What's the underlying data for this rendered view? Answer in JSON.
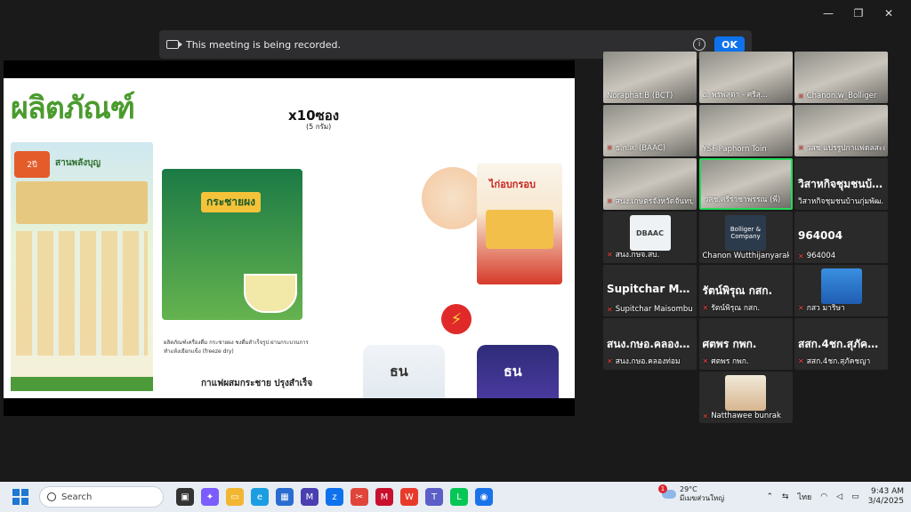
{
  "window": {
    "minimize": "—",
    "restore": "❐",
    "close": "✕"
  },
  "recording": {
    "message": "This meeting is being recorded.",
    "info": "i",
    "ok_label": "OK"
  },
  "slide": {
    "title": "ผลิตภัณฑ์",
    "brand": "สานพลังบุญ",
    "ribbon": "2ปี",
    "box_label": "กระชายผง",
    "qty": "x10ซอง",
    "qty_sub": "(5 กรัม)",
    "product_note": "ผลิตภัณฑ์เครื่องดื่ม กระชายผง ชงดื่มสำเร็จรูป ผ่านกระบวนการทำแห้งเยือกแข็ง (freeze dry)",
    "coffee_title": "กาแฟผสมกระชาย ปรุงสำเร็จ",
    "chip_title": "ไก่อบกรอบ",
    "can_brand": "ธน"
  },
  "participants": [
    {
      "name": "Noraphat.B (BCT)",
      "kind": "video",
      "muted": false
    },
    {
      "name": "อ. พรพสุดา - ศรีสุ...",
      "kind": "video",
      "muted": false
    },
    {
      "name": "Chanon.w_Bolliger",
      "kind": "video",
      "muted": true
    },
    {
      "name": "ธ.ก.ส. (BAAC)",
      "kind": "video",
      "muted": true
    },
    {
      "name": "YSF Paphorn Toin",
      "kind": "video",
      "muted": false
    },
    {
      "name": "วสช แปรรูปกาแฟดลสะดือ...",
      "kind": "video",
      "muted": true
    },
    {
      "name": "สนง.เกษตรจังหวัดจันทบุรี...",
      "kind": "video",
      "muted": true
    },
    {
      "name": "วสช.ศรีราชาพรรณ (พี่)",
      "kind": "video",
      "muted": false,
      "active": true
    },
    {
      "name": "วิสาหกิจชุมชนบ้านกุ่มพัฒ...",
      "kind": "name",
      "big": "วิสาหกิจชุมชนบ้า...",
      "muted": false
    },
    {
      "name": "สนง.กษจ.สบ.",
      "kind": "avatar",
      "avatar": "dbaac",
      "avatar_text": "DBAAC",
      "muted": true
    },
    {
      "name": "Chanon Wutthijanyarak",
      "kind": "avatar",
      "avatar": "logo",
      "avatar_text": "Bolliger & Company",
      "muted": false
    },
    {
      "name": "964004",
      "kind": "name",
      "big": "964004",
      "muted": true
    },
    {
      "name": "Supitchar Maisombun",
      "kind": "name",
      "big": "Supitchar Maiso...",
      "muted": true
    },
    {
      "name": "รัตน์พิรุณ กสก.",
      "kind": "name",
      "big": "รัตน์พิรุณ กสก.",
      "muted": true
    },
    {
      "name": "กสว มาริษา",
      "kind": "avatar",
      "avatar": "blue",
      "muted": true
    },
    {
      "name": "สนง.กษอ.คลองท่อม",
      "kind": "name",
      "big": "สนง.กษอ.คลองท่อม",
      "muted": true
    },
    {
      "name": "ศตพร กพก.",
      "kind": "name",
      "big": "ศตพร กพก.",
      "muted": true
    },
    {
      "name": "สสก.4ชก.สุภัคชญา",
      "kind": "name",
      "big": "สสก.4ชก.สุภัคชญา",
      "muted": true
    },
    {
      "name": "Natthawee bunrak",
      "kind": "avatar",
      "avatar": "person",
      "muted": true
    }
  ],
  "taskbar": {
    "search_placeholder": "Search",
    "weather_temp": "29°C",
    "weather_desc": "มีเมฆส่วนใหญ่",
    "weather_badge": "1",
    "lang": "ไทย",
    "time": "9:43 AM",
    "date": "3/4/2025",
    "apps": [
      {
        "icon": "taskview-icon",
        "color": "#333333",
        "glyph": "▣"
      },
      {
        "icon": "copilot-icon",
        "color": "#7b5cff",
        "glyph": "✦"
      },
      {
        "icon": "explorer-icon",
        "color": "#f2b632",
        "glyph": "▭"
      },
      {
        "icon": "edge-icon",
        "color": "#1b9de2",
        "glyph": "e"
      },
      {
        "icon": "store-icon",
        "color": "#2b6cd1",
        "glyph": "▦"
      },
      {
        "icon": "pen-icon",
        "color": "#4a3fb0",
        "glyph": "M"
      },
      {
        "icon": "zoom-icon",
        "color": "#0e72ed",
        "glyph": "z"
      },
      {
        "icon": "snip-icon",
        "color": "#e0443a",
        "glyph": "✂"
      },
      {
        "icon": "mcafee-icon",
        "color": "#c8102e",
        "glyph": "M"
      },
      {
        "icon": "wps-icon",
        "color": "#e83a2a",
        "glyph": "W"
      },
      {
        "icon": "teams-icon",
        "color": "#5b5fc7",
        "glyph": "T"
      },
      {
        "icon": "line-icon",
        "color": "#06c755",
        "glyph": "L"
      },
      {
        "icon": "app-icon",
        "color": "#1a73e8",
        "glyph": "◉"
      }
    ]
  }
}
